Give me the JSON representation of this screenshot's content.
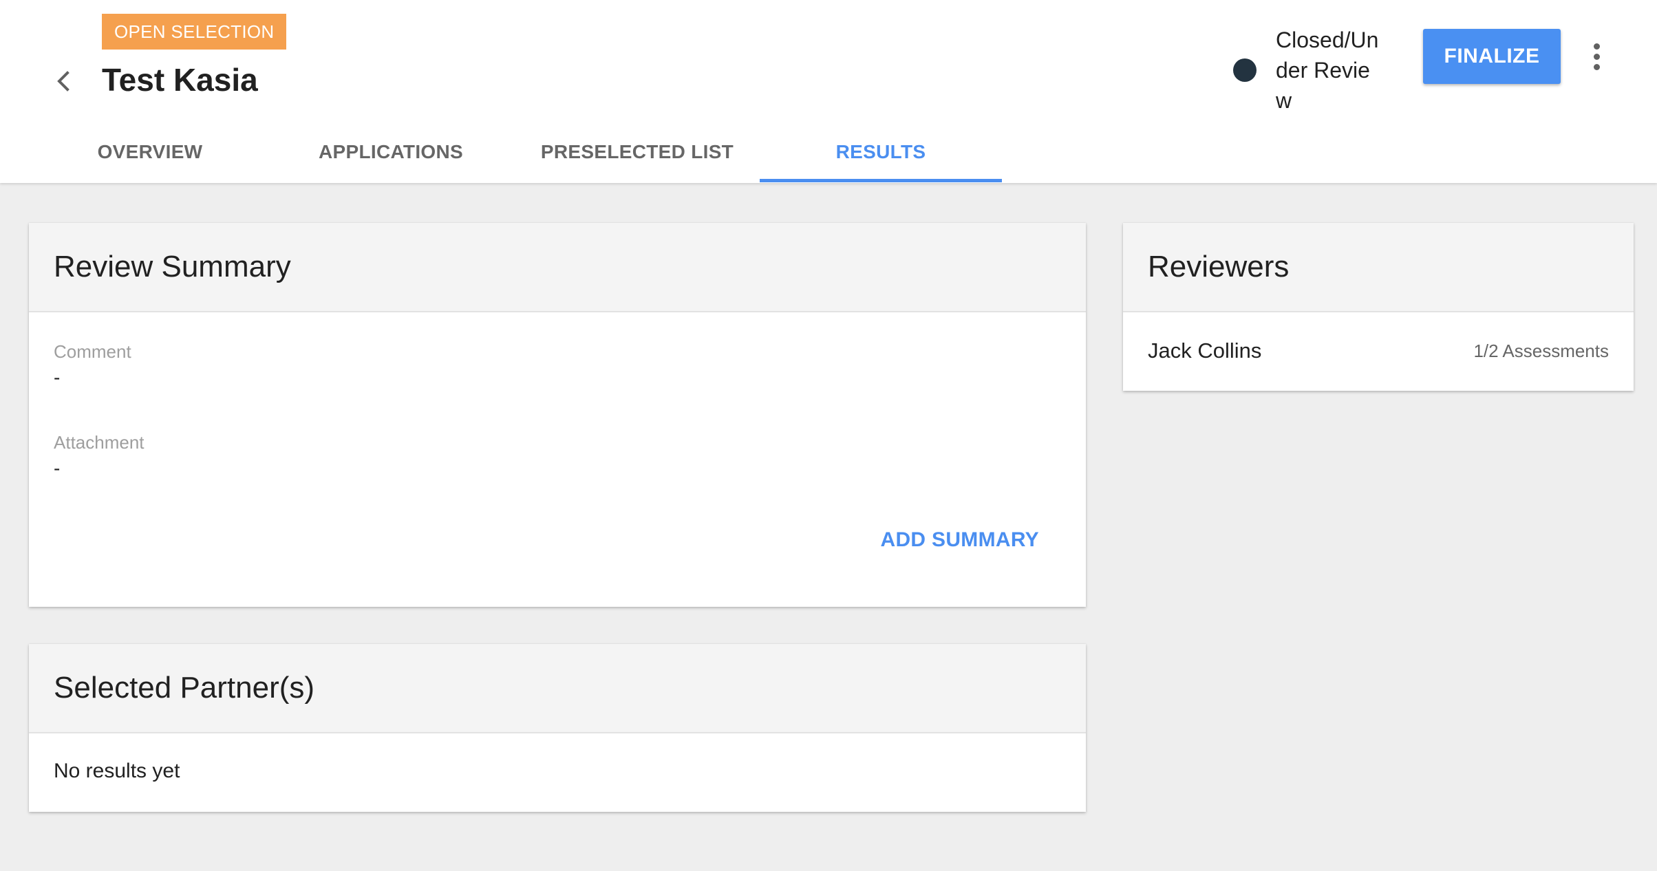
{
  "header": {
    "badge": "OPEN SELECTION",
    "title": "Test Kasia",
    "status_text": "Closed/Under Review",
    "finalize_label": "FINALIZE"
  },
  "tabs": [
    {
      "label": "OVERVIEW",
      "active": false
    },
    {
      "label": "APPLICATIONS",
      "active": false
    },
    {
      "label": "PRESELECTED LIST",
      "active": false
    },
    {
      "label": "RESULTS",
      "active": true
    }
  ],
  "review_summary": {
    "title": "Review Summary",
    "comment_label": "Comment",
    "comment_value": "-",
    "attachment_label": "Attachment",
    "attachment_value": "-",
    "add_summary_label": "ADD SUMMARY"
  },
  "selected_partners": {
    "title": "Selected Partner(s)",
    "empty_text": "No results yet"
  },
  "reviewers": {
    "title": "Reviewers",
    "items": [
      {
        "name": "Jack Collins",
        "assessments": "1/2 Assessments"
      }
    ]
  },
  "colors": {
    "accent": "#4a8ef0",
    "badge": "#f5a04e",
    "status_dot": "#233340",
    "background": "#eeeeee"
  }
}
